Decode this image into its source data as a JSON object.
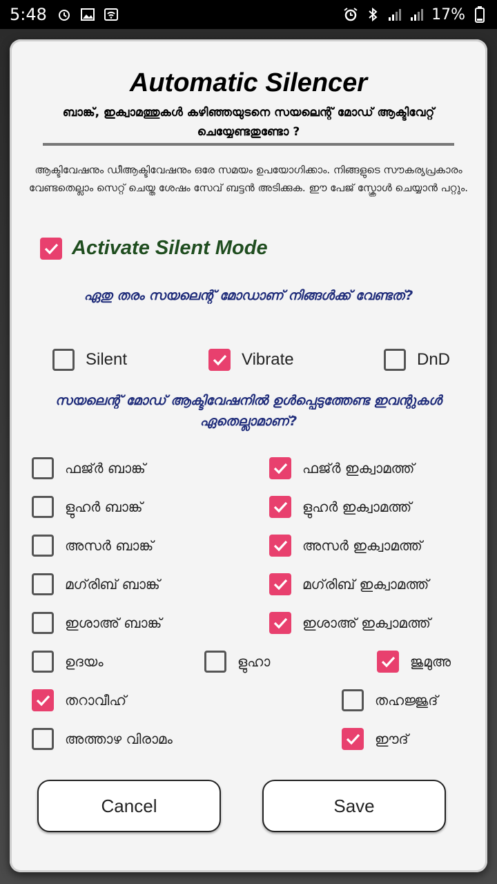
{
  "status_bar": {
    "time": "5:48",
    "battery": "17%",
    "left_icons": [
      "alarm-clock-icon",
      "image-icon",
      "wifi-box-icon"
    ],
    "right_icons": [
      "alarm-icon",
      "bluetooth-icon",
      "signal-icon",
      "signal-icon"
    ]
  },
  "dialog": {
    "title": "Automatic Silencer",
    "subtitle": "ബാങ്ക്, ഇക്വാമത്തുകൾ കഴിഞ്ഞയുടനെ സയലെന്റ് മോഡ് ആക്ടിവേറ്റ് ചെയ്യേണ്ടതുണ്ടോ ?",
    "description": "ആക്ടിവേഷനും ഡീആക്ടിവേഷനും ഒരേ സമയം ഉപയോഗിക്കാം. നിങ്ങളുടെ സൗകര്യപ്രകാരം വേണ്ടതെല്ലാം സെറ്റ് ചെയ്ത ശേഷം സേവ് ബട്ടൻ അടിക്കുക. ഈ പേജ് സ്ക്രോൾ ചെയ്യാൻ പറ്റും.",
    "master": {
      "label": "Activate Silent Mode",
      "checked": true
    },
    "mode_question": "ഏതു തരം സയലെന്റ് മോഡാണ് നിങ്ങൾക്ക് വേണ്ടത്?",
    "modes": [
      {
        "label": "Silent",
        "checked": false
      },
      {
        "label": "Vibrate",
        "checked": true
      },
      {
        "label": "DnD",
        "checked": false
      }
    ],
    "events_question": "സയലെന്റ് മോഡ് ആക്ടിവേഷനിൽ ഉൾപ്പെടുത്തേണ്ട ഇവന്റുകൾ ഏതെല്ലാമാണ്?",
    "events": [
      {
        "label": "ഫജ്ർ ബാങ്ക്",
        "checked": false
      },
      {
        "label": "ഫജ്ർ ഇക്വാമത്ത്",
        "checked": true
      },
      {
        "label": "ളുഹർ ബാങ്ക്",
        "checked": false
      },
      {
        "label": "ളുഹർ ഇക്വാമത്ത്",
        "checked": true
      },
      {
        "label": "അസർ ബാങ്ക്",
        "checked": false
      },
      {
        "label": "അസർ ഇക്വാമത്ത്",
        "checked": true
      },
      {
        "label": "മഗ്‌രിബ് ബാങ്ക്",
        "checked": false
      },
      {
        "label": "മഗ്‌രിബ് ഇക്വാമത്ത്",
        "checked": true
      },
      {
        "label": "ഇശാഅ് ബാങ്ക്",
        "checked": false
      },
      {
        "label": "ഇശാഅ് ഇക്വാമത്ത്",
        "checked": true
      },
      {
        "label": "ഉദയം",
        "checked": false
      },
      {
        "label": "ളുഹാ",
        "checked": false
      },
      {
        "label": "ജുമുഅ",
        "checked": true
      },
      {
        "label": "തറാവീഹ്",
        "checked": true
      },
      {
        "label": "തഹജ്ജുദ്",
        "checked": false
      },
      {
        "label": "അത്താഴ വിരാമം",
        "checked": false
      },
      {
        "label": "ഈദ്",
        "checked": true
      }
    ],
    "cancel_label": "Cancel",
    "save_label": "Save"
  }
}
